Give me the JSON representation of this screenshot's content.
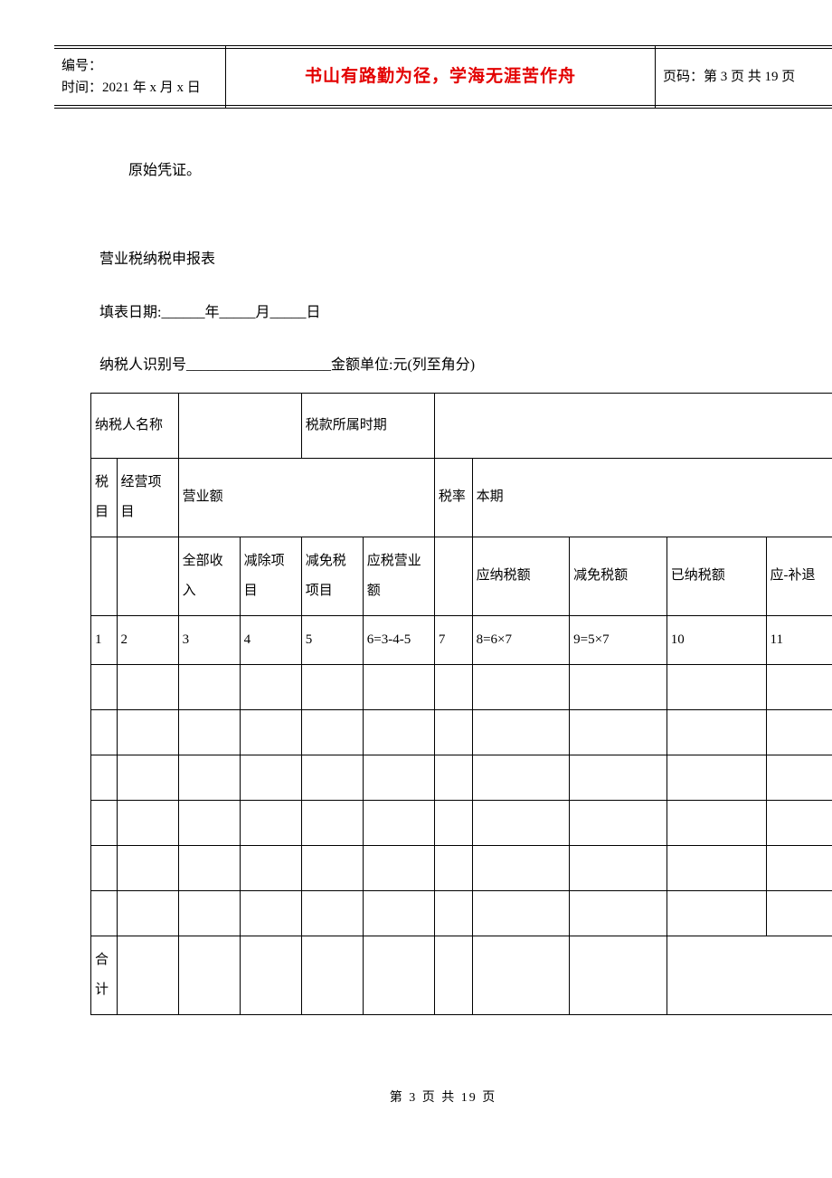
{
  "header": {
    "number_label": "编号：",
    "time_label": "时间：2021 年 x 月 x 日",
    "motto": "书山有路勤为径，学海无涯苦作舟",
    "page_label": "页码：第 3 页  共 19 页"
  },
  "body": {
    "line1": "原始凭证。",
    "form_title": "营业税纳税申报表",
    "fill_date": "填表日期:______年_____月_____日",
    "taxpayer_id": "纳税人识别号____________________金额单位:元(列至角分)"
  },
  "table": {
    "r1c1": "纳税人名称",
    "r1c3": "税款所属时期",
    "r2": {
      "c1": "税目",
      "c2": "经营项目",
      "c3": "营业额",
      "c4": "税率",
      "c5": "本期"
    },
    "r3": {
      "c3": "全部收入",
      "c4": "减除项目",
      "c5": "减免税项目",
      "c6": "应税营业额",
      "c8": "应纳税额",
      "c9": "减免税额",
      "c10": "已纳税额",
      "c11": "应-补退"
    },
    "r4": {
      "c1": "1",
      "c2": "2",
      "c3": "3",
      "c4": "4",
      "c5": "5",
      "c6": "6=3-4-5",
      "c7": "7",
      "c8": "8=6×7",
      "c9": "9=5×7",
      "c10": "10",
      "c11": "11"
    },
    "total": "合计"
  },
  "footer": "第  3  页  共  19  页"
}
